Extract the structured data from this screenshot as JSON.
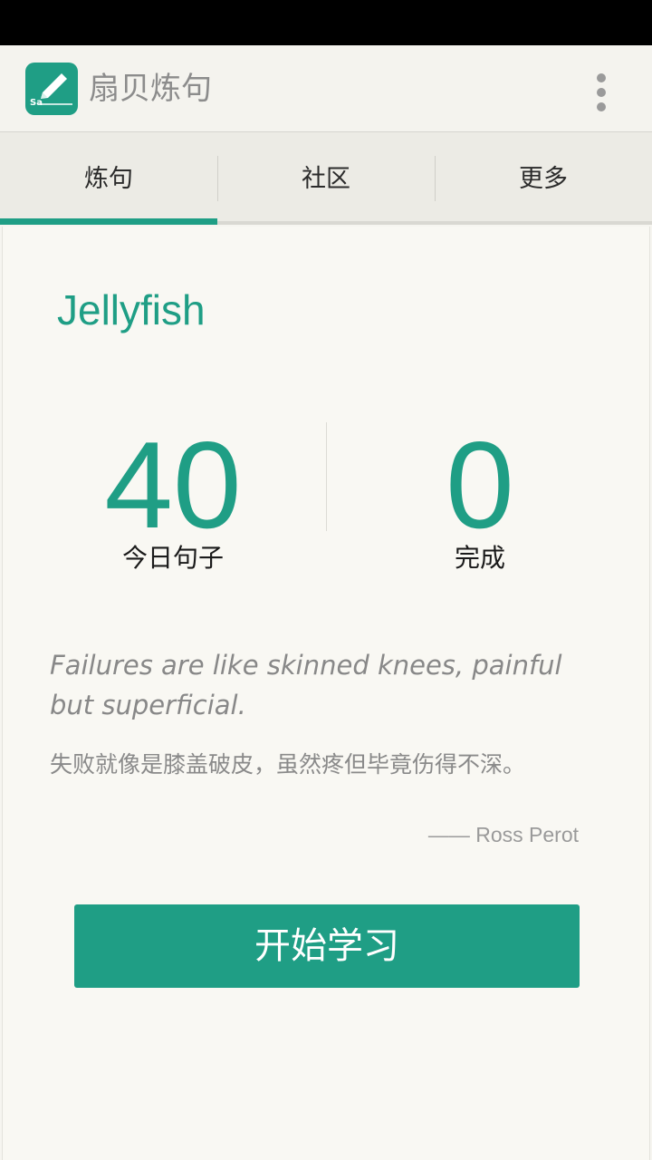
{
  "app": {
    "title": "扇贝炼句",
    "icon": "pencil-icon",
    "icon_text": "Sa",
    "accent_color": "#1f9e85"
  },
  "tabs": [
    {
      "label": "炼句",
      "selected": true
    },
    {
      "label": "社区",
      "selected": false
    },
    {
      "label": "更多",
      "selected": false
    }
  ],
  "profile": {
    "username": "Jellyfish"
  },
  "stats": {
    "today": {
      "value": "40",
      "label": "今日句子"
    },
    "done": {
      "value": "0",
      "label": "完成"
    }
  },
  "quote": {
    "english": "Failures are like skinned knees, painful but superficial.",
    "chinese": "失败就像是膝盖破皮，虽然疼但毕竟伤得不深。",
    "author": "—— Ross Perot"
  },
  "actions": {
    "start_label": "开始学习"
  }
}
